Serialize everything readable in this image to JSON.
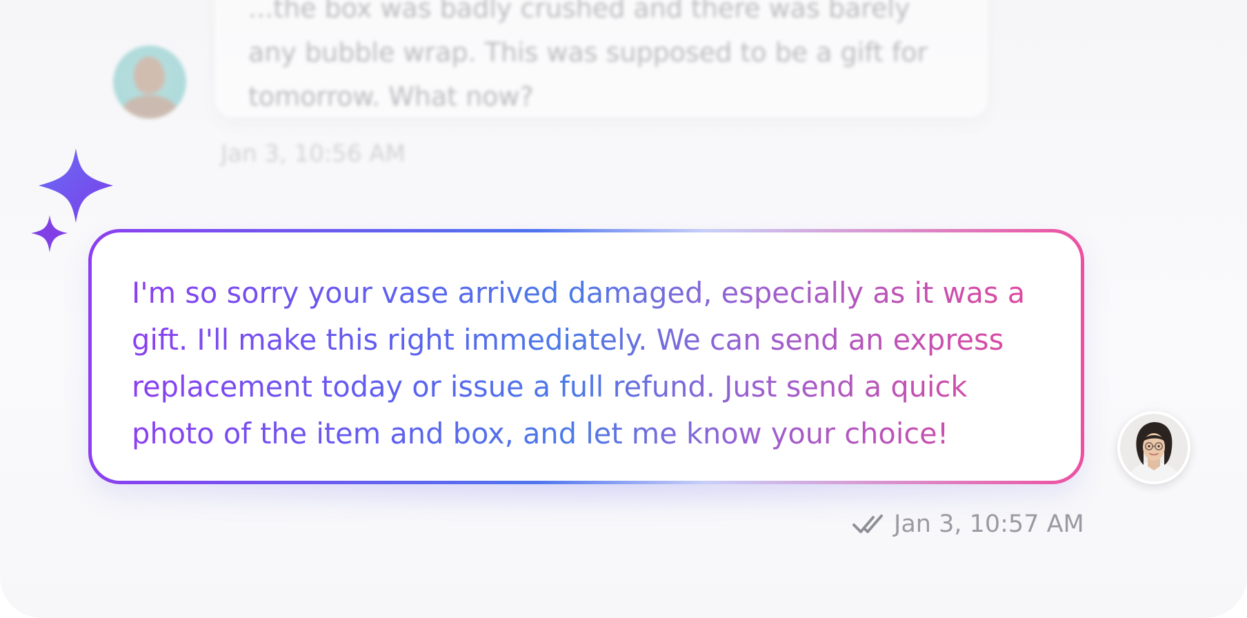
{
  "conversation": {
    "previous_message": {
      "text": "...the box was badly crushed and there was barely any bubble wrap. This was supposed to be a gift for tomorrow. What now?",
      "timestamp": "Jan 3, 10:56 AM",
      "avatar_icon": "customer-avatar"
    },
    "reply": {
      "text": "I'm so sorry your vase arrived damaged, especially as it was a gift. I'll make this right immediately. We can send an express replacement today or issue a full refund. Just send a quick photo of the item and box, and let me know your choice!",
      "timestamp": "Jan 3, 10:57 AM",
      "status_icon": "double-check-icon",
      "ai_icon": "sparkles-icon",
      "avatar_icon": "agent-avatar"
    }
  },
  "colors": {
    "gradient_purple": "#8b3ff0",
    "gradient_blue": "#4f74ee",
    "gradient_pink": "#ec4fa0",
    "timestamp_gray": "#9a9aa2"
  }
}
